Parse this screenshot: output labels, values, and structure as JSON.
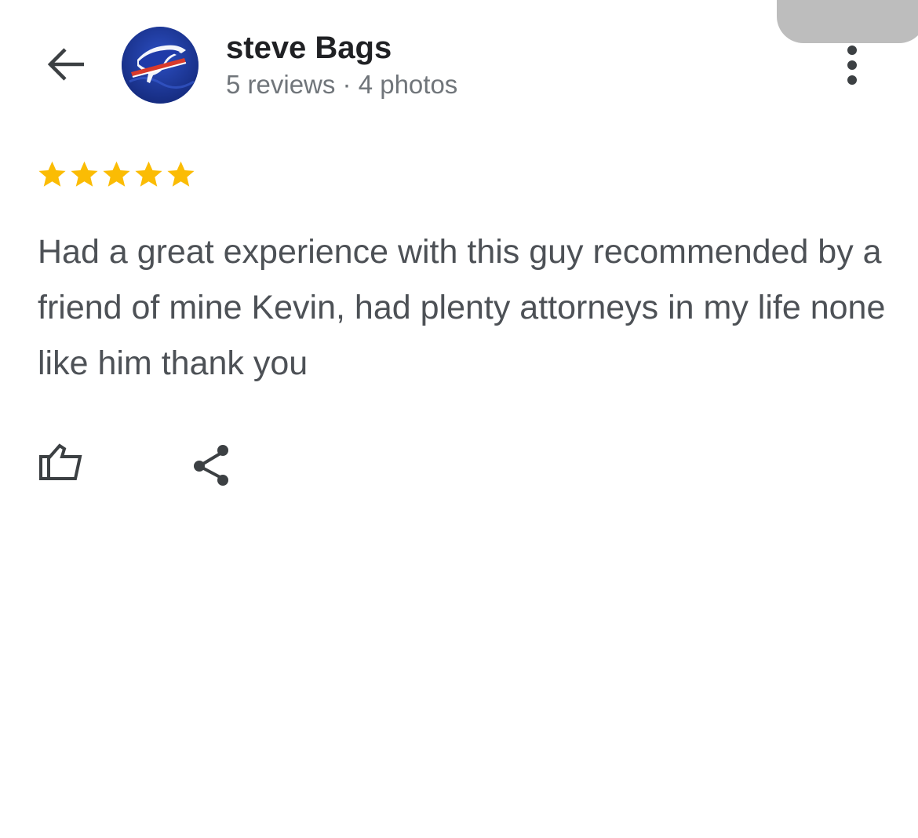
{
  "header": {
    "back_icon": "arrow-left-icon",
    "avatar_icon": "buffalo-logo-avatar",
    "name": "steve Bags",
    "meta": "5 reviews · 4 photos",
    "more_icon": "more-vert-icon"
  },
  "review": {
    "rating": 5,
    "rating_max": 5,
    "star_color": "#fbbc04",
    "text": "Had a great experience with this guy recommended by a friend of mine Kevin, had plenty attorneys in my life none like him thank you"
  },
  "actions": {
    "like_icon": "thumbs-up-icon",
    "share_icon": "share-icon"
  }
}
